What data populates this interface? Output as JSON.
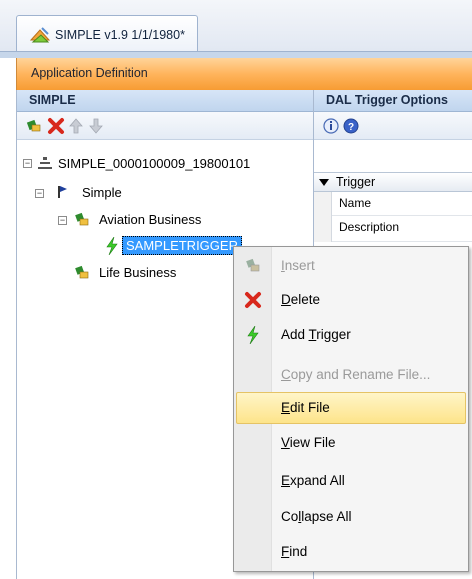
{
  "window": {
    "tab_title": "SIMPLE v1.9 1/1/1980*",
    "app_header": "Application Definition"
  },
  "left_panel": {
    "title": "SIMPLE",
    "toolbar": [
      "add-node-icon",
      "delete-x-icon",
      "move-up-arrow-icon",
      "move-down-arrow-icon"
    ],
    "tree": [
      {
        "label": "SIMPLE_0000100009_19800101",
        "icon": "stack-icon",
        "expander": "-"
      },
      {
        "label": "Simple",
        "icon": "flag-icon",
        "expander": "-"
      },
      {
        "label": "Aviation Business",
        "icon": "green-node-icon",
        "expander": "-"
      },
      {
        "label": "SAMPLETRIGGER",
        "icon": "lightning-icon",
        "selected": true
      },
      {
        "label": "Life Business",
        "icon": "green-node-icon"
      }
    ]
  },
  "right_panel": {
    "title": "DAL Trigger Options",
    "toolbar": [
      "info-icon",
      "help-icon"
    ],
    "section": "Trigger",
    "rows": [
      "Name",
      "Description"
    ]
  },
  "context_menu": {
    "items": [
      {
        "label": "Insert",
        "underline": "I",
        "rest": "nsert",
        "disabled": true,
        "icon": "insert-icon"
      },
      {
        "label": "Delete",
        "underline": "D",
        "rest": "elete",
        "disabled": false,
        "icon": "delete-x-icon"
      },
      {
        "label": "Add Trigger",
        "pre": "Add ",
        "underline": "T",
        "rest": "rigger",
        "disabled": false,
        "icon": "lightning-icon"
      },
      {
        "label": "Copy and Rename File...",
        "underline": "C",
        "rest": "opy and Rename File...",
        "disabled": true
      },
      {
        "label": "Edit File",
        "underline": "E",
        "rest": "dit File",
        "disabled": false,
        "highlighted": true
      },
      {
        "label": "View File",
        "underline": "V",
        "rest": "iew File",
        "disabled": false
      },
      {
        "label": "Expand All",
        "underline": "E",
        "rest": "xpand All",
        "disabled": false
      },
      {
        "label": "Collapse All",
        "pre": "Co",
        "underline": "l",
        "rest": "lapse All",
        "disabled": false
      },
      {
        "label": "Find",
        "underline": "F",
        "rest": "ind",
        "disabled": false
      }
    ]
  }
}
